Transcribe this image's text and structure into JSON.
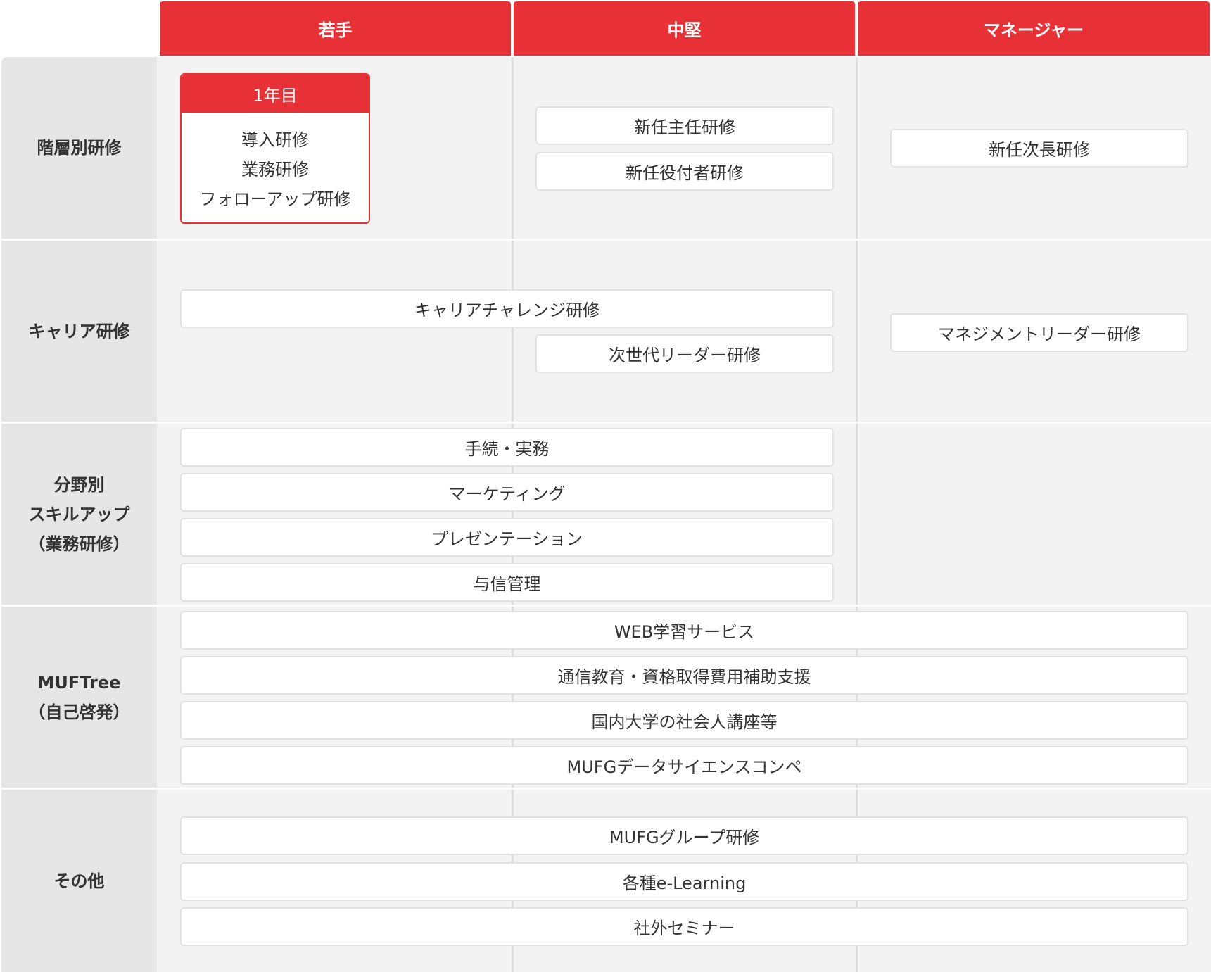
{
  "columns": [
    "若手",
    "中堅",
    "マネージャー"
  ],
  "rows": [
    {
      "label_lines": [
        "階層別研修"
      ]
    },
    {
      "label_lines": [
        "キャリア研修"
      ]
    },
    {
      "label_lines": [
        "分野別",
        "スキルアップ",
        "（業務研修）"
      ]
    },
    {
      "label_lines": [
        "MUFTree",
        "（自己啓発）"
      ]
    },
    {
      "label_lines": [
        "その他"
      ]
    }
  ],
  "first_year": {
    "title": "1年目",
    "items": [
      "導入研修",
      "業務研修",
      "フォローアップ研修"
    ]
  },
  "programs": {
    "shinnin_shunin": "新任主任研修",
    "shinnin_yakutsukisha": "新任役付者研修",
    "shinnin_jicho": "新任次長研修",
    "career_challenge": "キャリアチャレンジ研修",
    "jisedai_leader": "次世代リーダー研修",
    "management_leader": "マネジメントリーダー研修",
    "tetsuzuki_jitsumu": "手続・実務",
    "marketing": "マーケティング",
    "presentation": "プレゼンテーション",
    "yoshin_kanri": "与信管理",
    "web_learning": "WEB学習サービス",
    "tsushin_kyoiku": "通信教育・資格取得費用補助支援",
    "kokunai_daigaku": "国内大学の社会人講座等",
    "datascience": "MUFGデータサイエンスコンペ",
    "group_kenshu": "MUFGグループ研修",
    "elearning": "各種e-Learning",
    "shagai_seminar": "社外セミナー"
  },
  "colors": {
    "accent": "#e83137",
    "row_label_bg": "#e6e6e6",
    "row_bg": "#f3f3f3",
    "box_border": "#e2e2e2"
  }
}
